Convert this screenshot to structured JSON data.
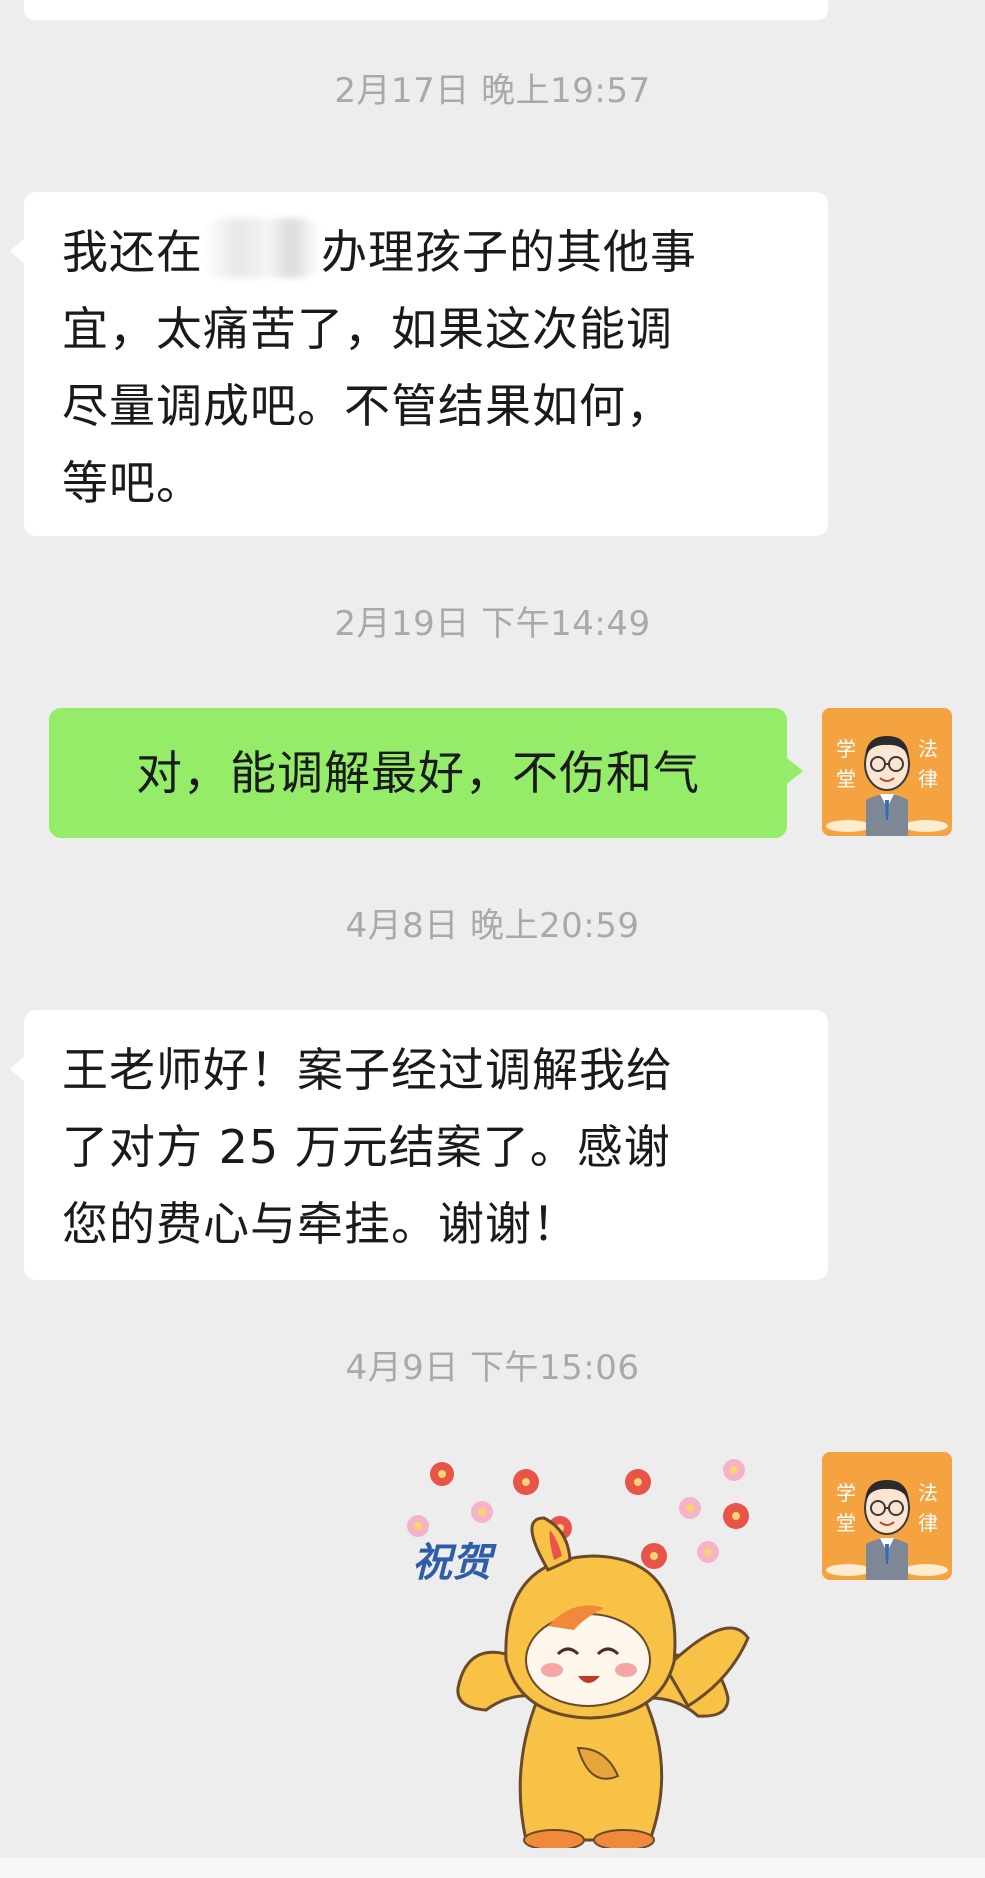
{
  "chat": {
    "messages": [
      {
        "type": "timestamp",
        "text": "2月17日 晚上19:57"
      },
      {
        "type": "incoming",
        "lines": [
          "我还在",
          "办理孩子的其他事",
          "宜，太痛苦了，如果这次能调",
          "尽量调成吧。不管结果如何，",
          "等吧。"
        ]
      },
      {
        "type": "timestamp",
        "text": "2月19日 下午14:49"
      },
      {
        "type": "outgoing",
        "text": "对，能调解最好，不伤和气"
      },
      {
        "type": "timestamp",
        "text": "4月8日 晚上20:59"
      },
      {
        "type": "incoming",
        "lines": [
          "王老师好！案子经过调解我给",
          "了对方 25 万元结案了。感谢",
          "您的费心与牵挂。谢谢！"
        ]
      },
      {
        "type": "timestamp",
        "text": "4月9日 下午15:06"
      },
      {
        "type": "sticker",
        "caption": "祝贺",
        "icon": "congratulations-sticker"
      }
    ]
  },
  "avatar": {
    "left_chars": [
      "学",
      "堂"
    ],
    "right_chars": [
      "法",
      "律"
    ],
    "icon": "lawyer-avatar",
    "colors": {
      "background": "#f5a340",
      "text": "#ffffff"
    }
  },
  "colors": {
    "background": "#ededed",
    "incoming_bubble": "#ffffff",
    "outgoing_bubble": "#95ec69",
    "timestamp": "#a9a9a9"
  }
}
